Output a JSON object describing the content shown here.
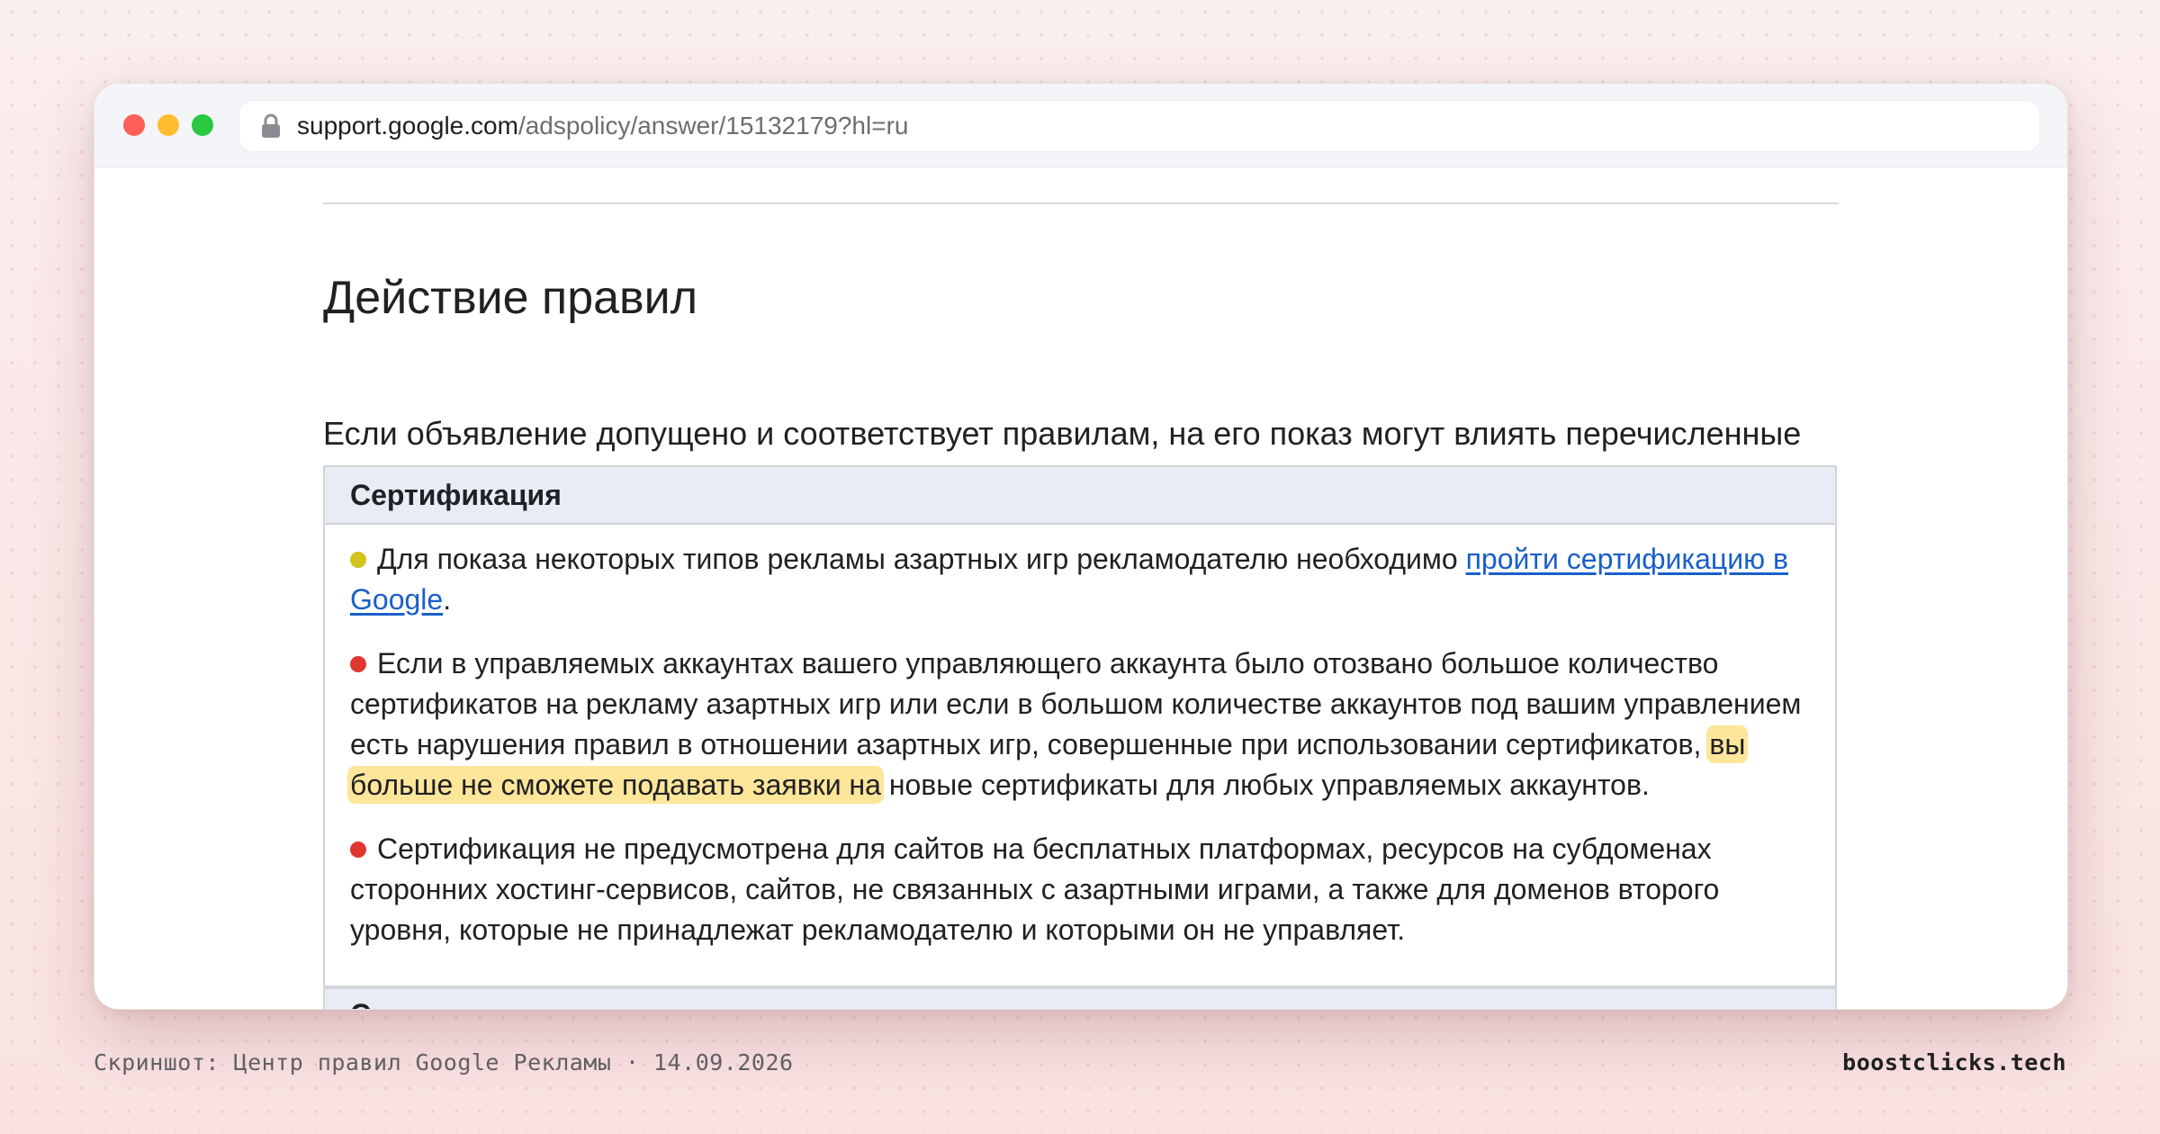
{
  "browser": {
    "url_domain": "support.google.com",
    "url_path": "/adspolicy/answer/15132179?hl=ru",
    "icons": [
      "close-dot",
      "minimize-dot",
      "maximize-dot",
      "lock-icon"
    ]
  },
  "article": {
    "heading": "Действие правил",
    "intro": "Если объявление допущено и соответствует правилам, на его показ могут влиять перечисленные ниже факторы.",
    "table": {
      "section_title": "Сертификация",
      "items": [
        {
          "bullet_color": "#d4c21f",
          "text_before": "Для показа некоторых типов рекламы азартных игр рекламодателю необходимо ",
          "link": "пройти сертификацию в Google",
          "text_after": "."
        },
        {
          "bullet_color": "#e0362f",
          "text_before": "Если в управляемых аккаунтах вашего управляющего аккаунта было отозвано большое количество сертификатов на рекламу азартных игр или если в большом количестве аккаунтов под вашим управлением есть нарушения правил в отношении азартных игр, совершенные при использовании сертификатов, ",
          "highlight": "вы больше не сможете подавать заявки на",
          "text_after": " новые сертификаты для любых управляемых аккаунтов."
        },
        {
          "bullet_color": "#e0362f",
          "text": "Сертификация не предусмотрена для сайтов на бесплатных платформах, ресурсов на субдоменах сторонних хостинг-сервисов, сайтов, не связанных с азартными играми, а также для доменов второго уровня, которые не принадлежат рекламодателю и которыми он не управляет."
        }
      ],
      "next_section_partial": "С"
    }
  },
  "captions": {
    "left": "Скриншот: Центр правил Google Рекламы · 14.09.2026",
    "right": "boostclicks.tech"
  },
  "colors": {
    "link": "#1a5fc9",
    "highlight": "#fde59a",
    "table_header_bg": "#e8edf5"
  }
}
